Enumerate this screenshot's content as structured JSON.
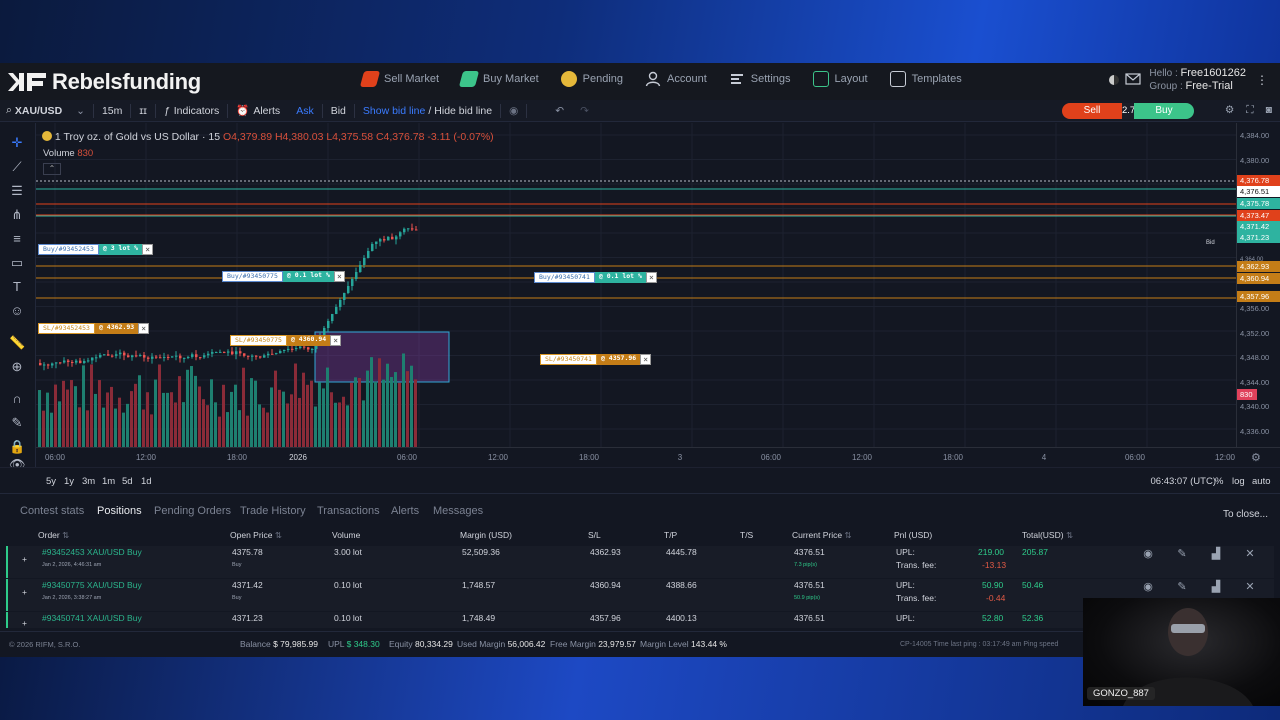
{
  "brand": {
    "name": "Rebelsfunding"
  },
  "nav": {
    "items": [
      {
        "label": "Sell Market",
        "icon": "sell-market-icon",
        "color": "#e0411b"
      },
      {
        "label": "Buy Market",
        "icon": "buy-market-icon",
        "color": "#3cc48a"
      },
      {
        "label": "Pending",
        "icon": "clock-icon",
        "color": "#e5b83a"
      },
      {
        "label": "Account",
        "icon": "user-icon",
        "color": "#9aa3b2"
      },
      {
        "label": "Settings",
        "icon": "settings-icon",
        "color": "#9aa3b2"
      },
      {
        "label": "Layout",
        "icon": "layout-icon",
        "color": "#3cc48a"
      },
      {
        "label": "Templates",
        "icon": "templates-icon",
        "color": "#9aa3b2"
      }
    ],
    "user": {
      "hello": "Hello :",
      "name": "Free1601262",
      "group_label": "Group :",
      "group": "Free-Trial"
    }
  },
  "toolbar": {
    "symbol": "XAU/USD",
    "interval": "15m",
    "indicators": "Indicators",
    "alerts": "Alerts",
    "ask": "Ask",
    "bid": "Bid",
    "show_bid_line": "Show bid line",
    "separator": "/",
    "hide_bid_line": "Hide bid line",
    "sell": "Sell",
    "spread": "2.7",
    "buy": "Buy"
  },
  "chart": {
    "title": "1 Troy oz. of Gold vs US Dollar · 15",
    "ohlc": "O4,379.89  H4,380.03  L4,375.58  C4,376.78  -3.11 (-0.07%)",
    "volume_label": "Volume",
    "volume_value": "830",
    "bid_label": "Bid",
    "tags": [
      {
        "label": "Buy/#93452453",
        "value": "@ 3 lot %",
        "kind": "buy"
      },
      {
        "label": "Buy/#93450775",
        "value": "@ 0.1 lot %",
        "kind": "buy"
      },
      {
        "label": "Buy/#93450741",
        "value": "@ 0.1 lot %",
        "kind": "buy"
      },
      {
        "label": "SL/#93452453",
        "value": "@ 4362.93",
        "kind": "sl"
      },
      {
        "label": "SL/#93450775",
        "value": "@ 4360.94",
        "kind": "sl"
      },
      {
        "label": "SL/#93450741",
        "value": "@ 4357.96",
        "kind": "sl"
      }
    ],
    "price_axis": [
      "4,384.00",
      "4,380.00",
      "4,376.00",
      "4,364.00",
      "4,356.00",
      "4,352.00",
      "4,348.00",
      "4,344.00",
      "4,340.00",
      "4,336.00"
    ],
    "price_markers": [
      {
        "label": "4,376.78",
        "color": "#e0411b"
      },
      {
        "label": "4,376.51",
        "color": "#ffffff"
      },
      {
        "label": "4,375.78",
        "color": "#2eb3a0"
      },
      {
        "label": "4,373.47",
        "color": "#e0411b"
      },
      {
        "label": "4,371.42",
        "color": "#2eb3a0"
      },
      {
        "label": "4,371.23",
        "color": "#2eb3a0"
      },
      {
        "label": "4,362.93",
        "color": "#c47d17"
      },
      {
        "label": "4,360.94",
        "color": "#c47d17"
      },
      {
        "label": "4,357.96",
        "color": "#c47d17"
      },
      {
        "label": "830",
        "color": "#e0415b"
      }
    ],
    "time_axis": [
      "06:00",
      "12:00",
      "18:00",
      "2026",
      "06:00",
      "12:00",
      "18:00",
      "3",
      "06:00",
      "12:00",
      "18:00",
      "4",
      "06:00",
      "12:00"
    ]
  },
  "ranges": [
    "5y",
    "1y",
    "3m",
    "1m",
    "5d",
    "1d"
  ],
  "clock": "06:43:07 (UTC)",
  "scale_buttons": [
    "%",
    "log",
    "auto"
  ],
  "bottom_tabs": [
    "Contest stats",
    "Positions",
    "Pending Orders",
    "Trade History",
    "Transactions",
    "Alerts",
    "Messages"
  ],
  "close_all": "To close...",
  "columns": [
    "Order",
    "Open Price",
    "Volume",
    "Margin (USD)",
    "S/L",
    "T/P",
    "T/S",
    "Current Price",
    "Pnl (USD)",
    "Total(USD)"
  ],
  "positions": [
    {
      "order": "#93452453 XAU/USD Buy",
      "date": "Jan 2, 2026, 4:46:31 am",
      "open": "4375.78",
      "side": "Buy",
      "volume": "3.00 lot",
      "margin": "52,509.36",
      "sl": "4362.93",
      "tp": "4445.78",
      "current": "4376.51",
      "pips": "7.3 pip(s)",
      "upl_label": "UPL:",
      "upl": "219.00",
      "fee_label": "Trans. fee:",
      "fee": "-13.13",
      "total": "205.87"
    },
    {
      "order": "#93450775 XAU/USD Buy",
      "date": "Jan 2, 2026, 3:38:27 am",
      "open": "4371.42",
      "side": "Buy",
      "volume": "0.10 lot",
      "margin": "1,748.57",
      "sl": "4360.94",
      "tp": "4388.66",
      "current": "4376.51",
      "pips": "50.9 pip(s)",
      "upl_label": "UPL:",
      "upl": "50.90",
      "fee_label": "Trans. fee:",
      "fee": "-0.44",
      "total": "50.46"
    },
    {
      "order": "#93450741 XAU/USD Buy",
      "date": "",
      "open": "4371.23",
      "side": "",
      "volume": "0.10 lot",
      "margin": "1,748.49",
      "sl": "4357.96",
      "tp": "4400.13",
      "current": "4376.51",
      "pips": "",
      "upl_label": "UPL:",
      "upl": "52.80",
      "fee_label": "",
      "fee": "",
      "total": "52.36"
    }
  ],
  "footer": {
    "copyright": "© 2026 RIFM, S.R.O.",
    "balance_label": "Balance",
    "balance": "$ 79,985.99",
    "upl_label": "UPL",
    "upl": "$ 348.30",
    "equity_label": "Equity",
    "equity": "80,334.29",
    "used_margin_label": "Used Margin",
    "used_margin": "56,006.42",
    "free_margin_label": "Free Margin",
    "free_margin": "23,979.57",
    "margin_level_label": "Margin Level",
    "margin_level": "143.44 %",
    "ping": "CP-14005 Time last ping : 03:17:49 am   Ping speed"
  },
  "webcam": {
    "name": "GONZO_887"
  }
}
